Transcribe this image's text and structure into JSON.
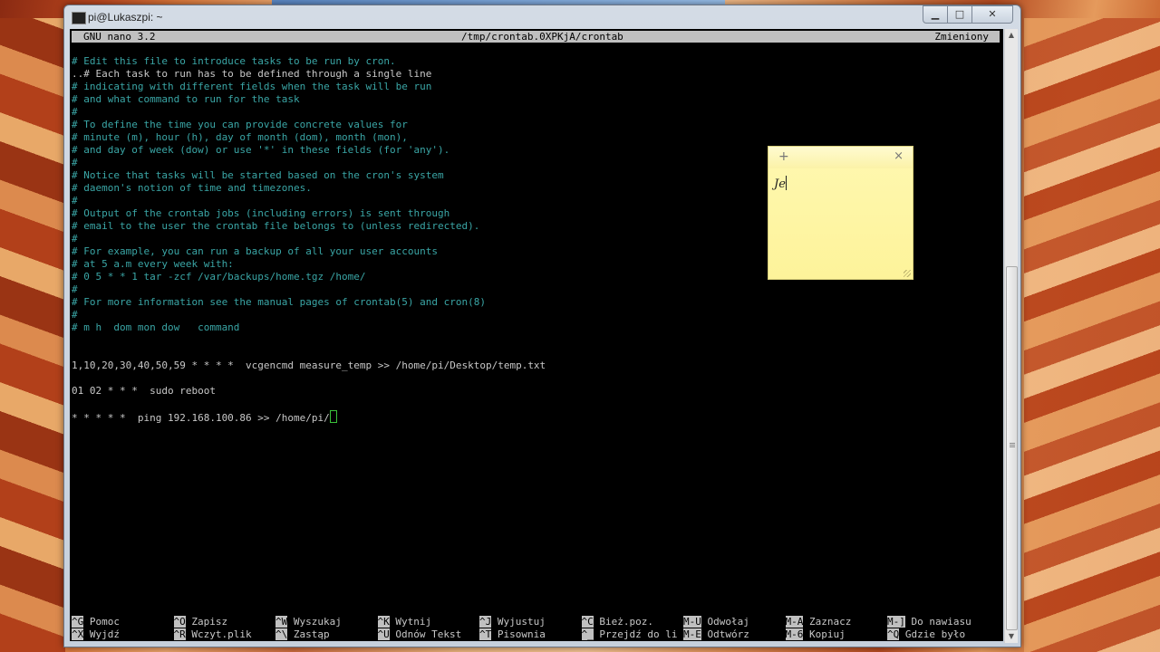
{
  "window": {
    "title": "pi@Lukaszpi: ~",
    "minimize": "▁",
    "maximize": "□",
    "close": "✕"
  },
  "nano": {
    "version": "GNU nano 3.2",
    "filename": "/tmp/crontab.0XPKjA/crontab",
    "status": "Zmieniony"
  },
  "lines": [
    {
      "text": "# Edit this file to introduce tasks to be run by cron.",
      "type": "comment"
    },
    {
      "text": "..# Each task to run has to be defined through a single line",
      "type": "normal"
    },
    {
      "text": "# indicating with different fields when the task will be run",
      "type": "comment"
    },
    {
      "text": "# and what command to run for the task",
      "type": "comment"
    },
    {
      "text": "#",
      "type": "comment"
    },
    {
      "text": "# To define the time you can provide concrete values for",
      "type": "comment"
    },
    {
      "text": "# minute (m), hour (h), day of month (dom), month (mon),",
      "type": "comment"
    },
    {
      "text": "# and day of week (dow) or use '*' in these fields (for 'any').",
      "type": "comment"
    },
    {
      "text": "#",
      "type": "comment"
    },
    {
      "text": "# Notice that tasks will be started based on the cron's system",
      "type": "comment"
    },
    {
      "text": "# daemon's notion of time and timezones.",
      "type": "comment"
    },
    {
      "text": "#",
      "type": "comment"
    },
    {
      "text": "# Output of the crontab jobs (including errors) is sent through",
      "type": "comment"
    },
    {
      "text": "# email to the user the crontab file belongs to (unless redirected).",
      "type": "comment"
    },
    {
      "text": "#",
      "type": "comment"
    },
    {
      "text": "# For example, you can run a backup of all your user accounts",
      "type": "comment"
    },
    {
      "text": "# at 5 a.m every week with:",
      "type": "comment"
    },
    {
      "text": "# 0 5 * * 1 tar -zcf /var/backups/home.tgz /home/",
      "type": "comment"
    },
    {
      "text": "#",
      "type": "comment"
    },
    {
      "text": "# For more information see the manual pages of crontab(5) and cron(8)",
      "type": "comment"
    },
    {
      "text": "#",
      "type": "comment"
    },
    {
      "text": "# m h  dom mon dow   command",
      "type": "comment"
    },
    {
      "text": "",
      "type": "normal"
    },
    {
      "text": "",
      "type": "normal"
    },
    {
      "text": "1,10,20,30,40,50,59 * * * *  vcgencmd measure_temp >> /home/pi/Desktop/temp.txt",
      "type": "normal"
    },
    {
      "text": "",
      "type": "normal"
    },
    {
      "text": "01 02 * * *  sudo reboot",
      "type": "normal"
    },
    {
      "text": "",
      "type": "normal"
    },
    {
      "text": "* * * * *  ping 192.168.100.86 >> /home/pi/",
      "type": "normal"
    }
  ],
  "shortcuts": [
    [
      {
        "key": "^G",
        "label": "Pomoc"
      },
      {
        "key": "^O",
        "label": "Zapisz"
      },
      {
        "key": "^W",
        "label": "Wyszukaj"
      },
      {
        "key": "^K",
        "label": "Wytnij"
      },
      {
        "key": "^J",
        "label": "Wyjustuj"
      },
      {
        "key": "^C",
        "label": "Bież.poz."
      },
      {
        "key": "M-U",
        "label": "Odwołaj"
      },
      {
        "key": "M-A",
        "label": "Zaznacz"
      },
      {
        "key": "M-]",
        "label": "Do nawiasu"
      }
    ],
    [
      {
        "key": "^X",
        "label": "Wyjdź"
      },
      {
        "key": "^R",
        "label": "Wczyt.plik"
      },
      {
        "key": "^\\",
        "label": "Zastąp"
      },
      {
        "key": "^U",
        "label": "Odnów Tekst"
      },
      {
        "key": "^T",
        "label": "Pisownia"
      },
      {
        "key": "^_",
        "label": "Przejdź do li"
      },
      {
        "key": "M-E",
        "label": "Odtwórz"
      },
      {
        "key": "M-6",
        "label": "Kopiuj"
      },
      {
        "key": "^Q",
        "label": "Gdzie było"
      }
    ]
  ],
  "sticky_note": {
    "add": "+",
    "close": "×",
    "text": "Je"
  },
  "scrollbar": {
    "up": "▲",
    "down": "▼"
  }
}
